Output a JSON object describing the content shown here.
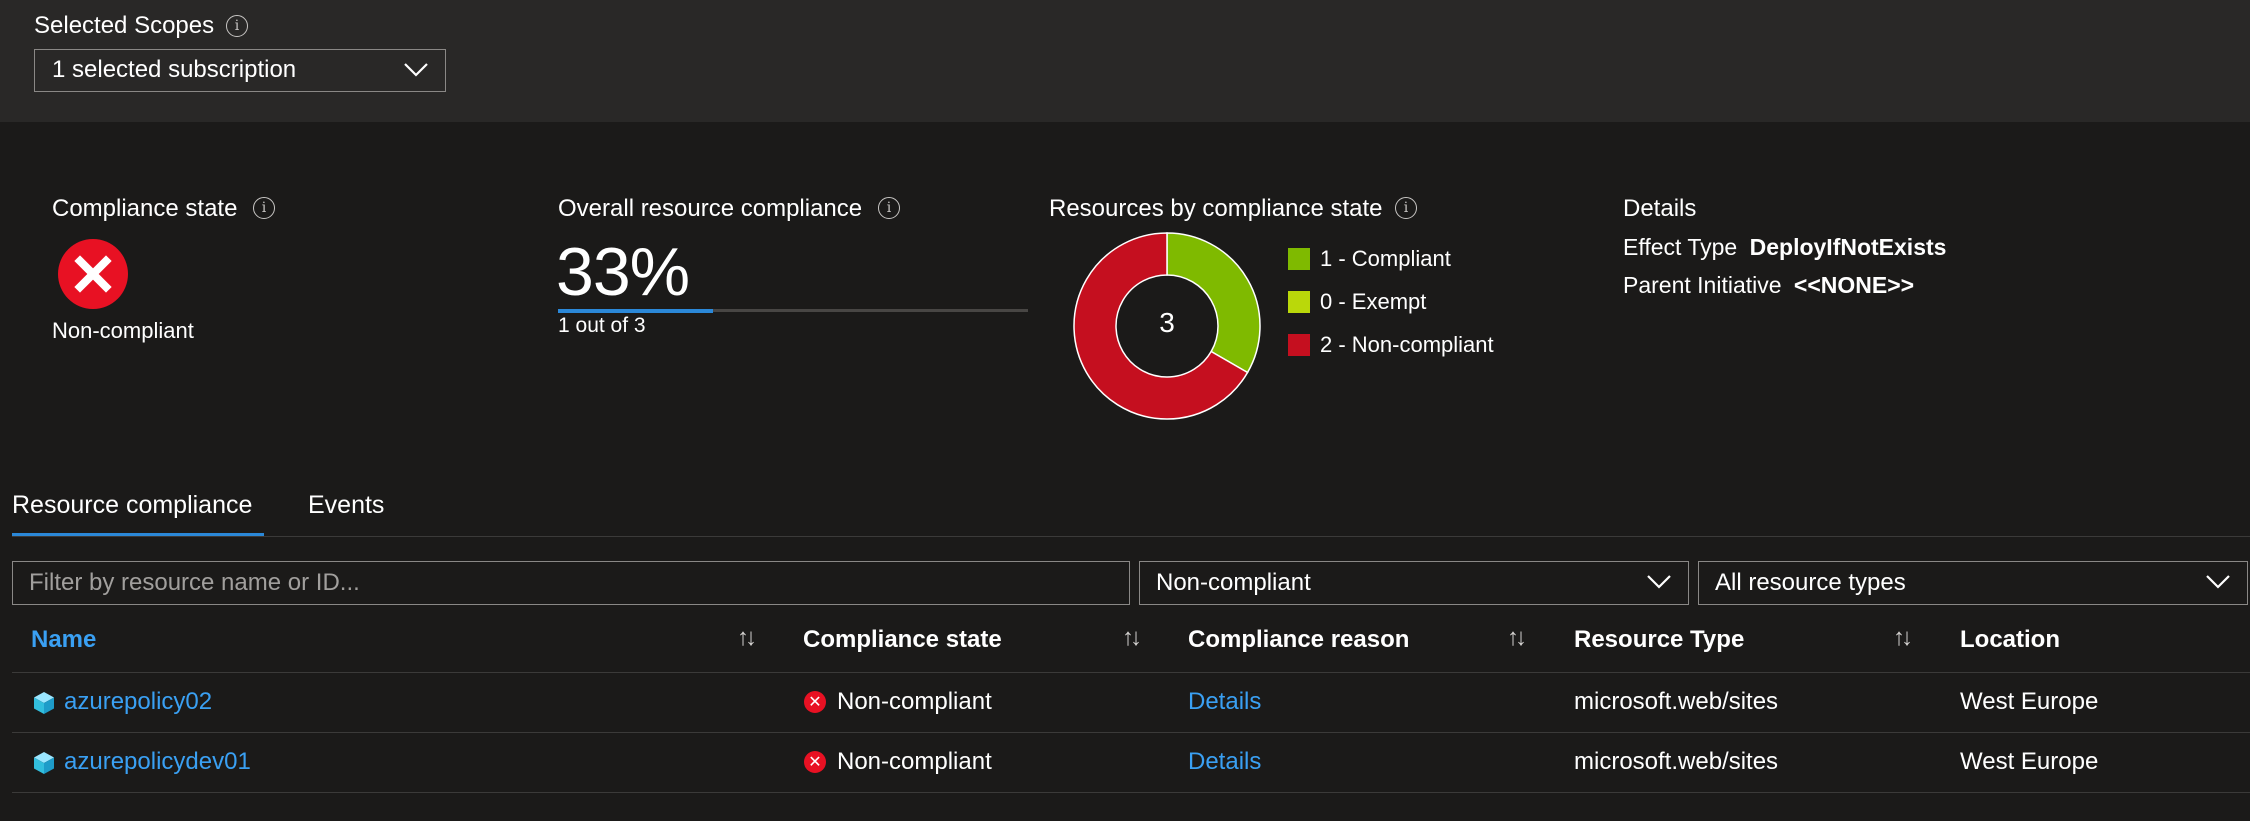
{
  "scopes": {
    "label": "Selected Scopes",
    "selected_value": "1 selected subscription"
  },
  "summary": {
    "compliance_state": {
      "label": "Compliance state",
      "value": "Non-compliant",
      "icon": "error-circle-icon"
    },
    "overall_compliance": {
      "label": "Overall resource compliance",
      "percent_text": "33%",
      "detail": "1 out of 3",
      "progress": 0.33
    },
    "resources_by_state": {
      "label": "Resources by compliance state",
      "total": "3",
      "legend": [
        {
          "label": "1 - Compliant",
          "count": 1,
          "color": "#7fba00"
        },
        {
          "label": "0 - Exempt",
          "count": 0,
          "color": "#bad80a"
        },
        {
          "label": "2 - Non-compliant",
          "count": 2,
          "color": "#c50f1f"
        }
      ]
    },
    "details": {
      "heading": "Details",
      "effect_type_label": "Effect Type",
      "effect_type_value": "DeployIfNotExists",
      "parent_initiative_label": "Parent Initiative",
      "parent_initiative_value": "<<NONE>>"
    }
  },
  "tabs": [
    {
      "label": "Resource compliance",
      "active": true
    },
    {
      "label": "Events",
      "active": false
    }
  ],
  "filters": {
    "search_placeholder": "Filter by resource name or ID...",
    "compliance_filter": "Non-compliant",
    "resource_type_filter": "All resource types"
  },
  "table": {
    "columns": [
      "Name",
      "Compliance state",
      "Compliance reason",
      "Resource Type",
      "Location"
    ],
    "rows": [
      {
        "name": "azurepolicy02",
        "state": "Non-compliant",
        "reason": "Details",
        "type": "microsoft.web/sites",
        "location": "West Europe"
      },
      {
        "name": "azurepolicydev01",
        "state": "Non-compliant",
        "reason": "Details",
        "type": "microsoft.web/sites",
        "location": "West Europe"
      }
    ]
  },
  "colors": {
    "accent": "#2b88d8",
    "link": "#3aa0f3",
    "error": "#e81123",
    "compliant": "#7fba00",
    "non_compliant": "#c50f1f"
  }
}
